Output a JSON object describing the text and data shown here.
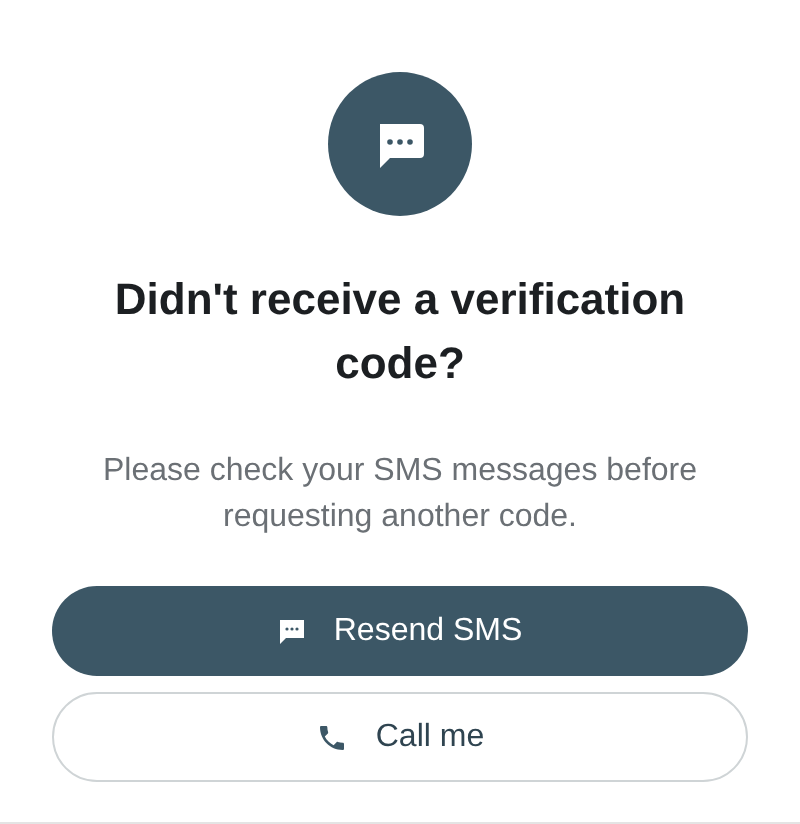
{
  "title": "Didn't receive a verification code?",
  "message": "Please check your SMS messages before requesting another code.",
  "buttons": [
    {
      "label": "Resend SMS",
      "kind": "primary"
    },
    {
      "label": "Call me",
      "kind": "outline"
    }
  ]
}
